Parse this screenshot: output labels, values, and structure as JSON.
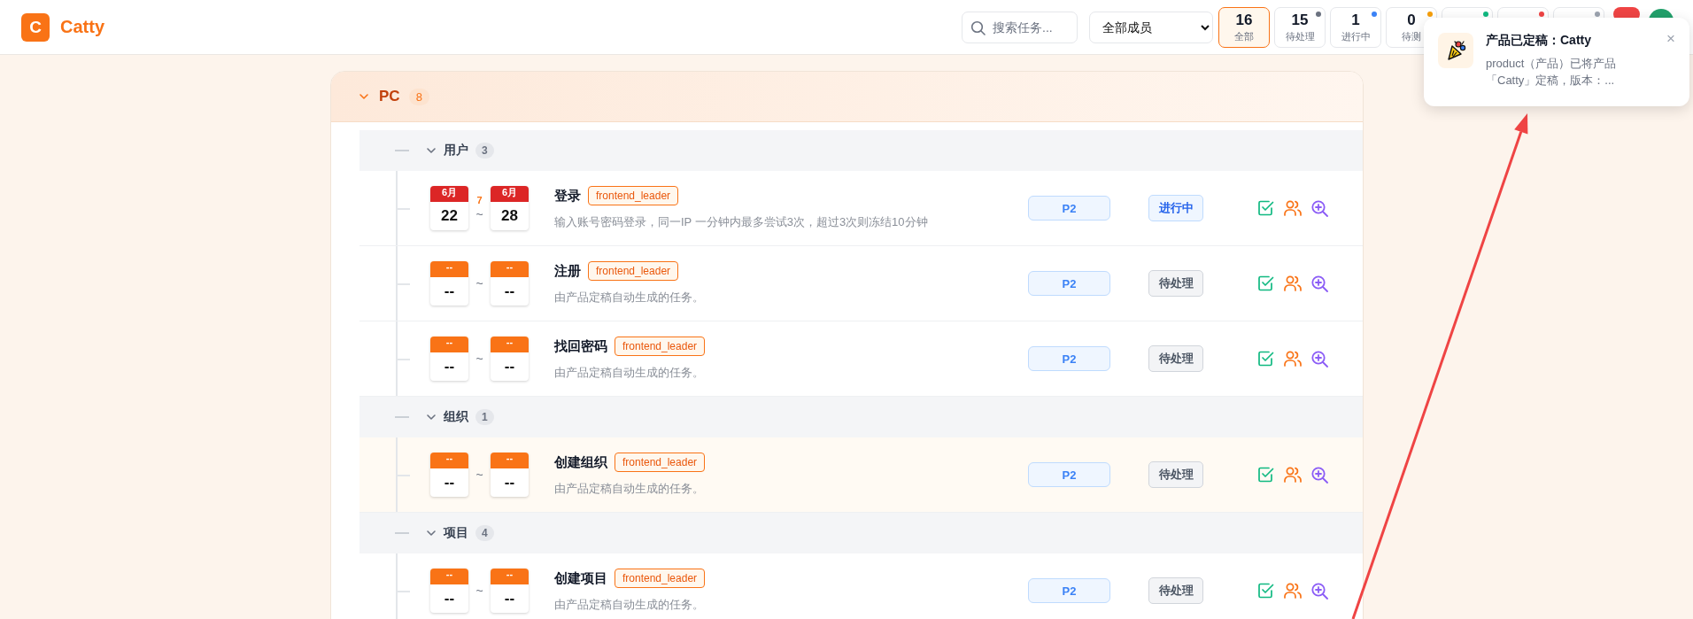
{
  "app": {
    "logo_letter": "C",
    "name": "Catty"
  },
  "toolbar": {
    "search": {
      "placeholder": "搜索任务..."
    },
    "member_filter": {
      "value": "全部成员"
    },
    "stats": [
      {
        "count": "16",
        "label": "全部",
        "selected": true
      },
      {
        "count": "15",
        "label": "待处理",
        "selected": false,
        "color": "#6b7280"
      },
      {
        "count": "1",
        "label": "进行中",
        "selected": false,
        "color": "#3b82f6"
      },
      {
        "count": "0",
        "label": "待测",
        "selected": false,
        "color": "#f59e0b"
      },
      {
        "selected": false,
        "color": "#10b981"
      },
      {
        "selected": false,
        "color": "#ef4444"
      },
      {
        "selected": false,
        "color": "#9ca3af"
      }
    ]
  },
  "notification": {
    "title": "产品已定稿：Catty",
    "message": "product（产品）已将产品「Catty」定稿，版本：...",
    "close": "×"
  },
  "project": {
    "name": "PC",
    "count": "8",
    "expanded": true,
    "modules": [
      {
        "name": "用户",
        "count": "3",
        "expanded": true,
        "tasks": [
          {
            "kind": "scheduled",
            "start": {
              "month": "6月",
              "day": "22"
            },
            "end": {
              "month": "6月",
              "day": "28"
            },
            "duration": "7",
            "separator": "~",
            "title": "登录",
            "assignee": "frontend_leader",
            "description": "输入账号密码登录，同一IP 一分钟内最多尝试3次，超过3次则冻结10分钟",
            "priority": "P2",
            "status": {
              "text": "进行中",
              "kind": "in_progress"
            },
            "highlighted": false
          },
          {
            "kind": "unscheduled",
            "start": {
              "month": "--",
              "day": "--"
            },
            "end": {
              "month": "--",
              "day": "--"
            },
            "separator": "~",
            "title": "注册",
            "assignee": "frontend_leader",
            "description": "由产品定稿自动生成的任务。",
            "priority": "P2",
            "status": {
              "text": "待处理",
              "kind": "pending"
            },
            "highlighted": false
          },
          {
            "kind": "unscheduled",
            "start": {
              "month": "--",
              "day": "--"
            },
            "end": {
              "month": "--",
              "day": "--"
            },
            "separator": "~",
            "title": "找回密码",
            "assignee": "frontend_leader",
            "description": "由产品定稿自动生成的任务。",
            "priority": "P2",
            "status": {
              "text": "待处理",
              "kind": "pending"
            },
            "highlighted": false
          }
        ]
      },
      {
        "name": "组织",
        "count": "1",
        "expanded": true,
        "tasks": [
          {
            "kind": "unscheduled",
            "start": {
              "month": "--",
              "day": "--"
            },
            "end": {
              "month": "--",
              "day": "--"
            },
            "separator": "~",
            "title": "创建组织",
            "assignee": "frontend_leader",
            "description": "由产品定稿自动生成的任务。",
            "priority": "P2",
            "status": {
              "text": "待处理",
              "kind": "pending"
            },
            "highlighted": true
          }
        ]
      },
      {
        "name": "项目",
        "count": "4",
        "expanded": true,
        "tasks": [
          {
            "kind": "unscheduled",
            "start": {
              "month": "--",
              "day": "--"
            },
            "end": {
              "month": "--",
              "day": "--"
            },
            "separator": "~",
            "title": "创建项目",
            "assignee": "frontend_leader",
            "description": "由产品定稿自动生成的任务。",
            "priority": "P2",
            "status": {
              "text": "待处理",
              "kind": "pending"
            },
            "highlighted": false
          }
        ]
      }
    ]
  }
}
